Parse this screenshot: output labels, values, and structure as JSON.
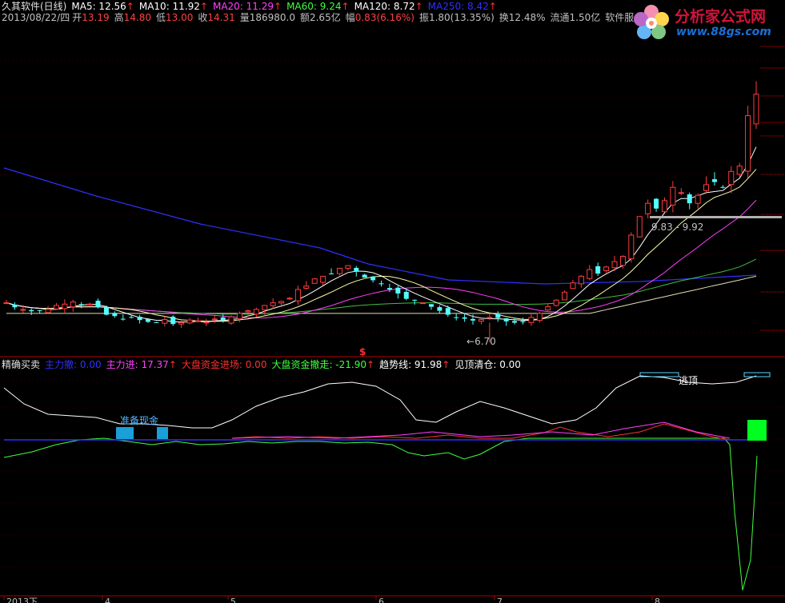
{
  "header": {
    "title": "久其软件(日线)",
    "ma": [
      {
        "label": "MA5: 12.56",
        "color": "#ffffff",
        "arrow": "↑"
      },
      {
        "label": "MA10: 11.92",
        "color": "#ffffff",
        "arrow": "↑"
      },
      {
        "label": "MA20: 11.29",
        "color": "#ff40ff",
        "arrow": "↑"
      },
      {
        "label": "MA60: 9.24",
        "color": "#40ff40",
        "arrow": "↑"
      },
      {
        "label": "MA120: 8.72",
        "color": "#ffffff",
        "arrow": "↑"
      },
      {
        "label": "MA250: 8.42",
        "color": "#3030ff",
        "arrow": "↑"
      }
    ],
    "quote": {
      "date": "2013/08/22/四",
      "open_label": "开",
      "open": "13.19",
      "high_label": "高",
      "high": "14.80",
      "low_label": "低",
      "low": "13.00",
      "close_label": "收",
      "close": "14.31",
      "vol": "量186980.0",
      "amt": "额2.65亿",
      "chg_label": "幅",
      "chg": "0.83(6.16%)",
      "amp": "振1.80(13.35%)",
      "turn": "换12.48%",
      "float": "流通1.50亿",
      "service": "软件服务"
    }
  },
  "logo": {
    "line1": "分析家公式网",
    "line2": "www.88gs.com"
  },
  "price_panel": {
    "range_label": "9.83 - 9.92",
    "low_marker": "6.70",
    "signal_marker": "$"
  },
  "indicator": {
    "name": "精确买卖",
    "items": [
      {
        "label": "主力撤: 0.00",
        "color": "#3030ff"
      },
      {
        "label": "主力进: 17.37",
        "color": "#ff40ff",
        "arrow": "↑"
      },
      {
        "label": "大盘资金进场: 0.00",
        "color": "#ff3030"
      },
      {
        "label": "大盘资金撤走: -21.90",
        "color": "#40ff40",
        "arrow": "↑"
      },
      {
        "label": "趋势线: 91.98",
        "color": "#ffffff",
        "arrow": "↑"
      },
      {
        "label": "见顶清仓: 0.00",
        "color": "#ffffff"
      }
    ],
    "escape_label": "逃顶",
    "cash_label": "准备现金"
  },
  "x_axis": {
    "labels": [
      "2013下",
      "4",
      "5",
      "6",
      "7",
      "8"
    ]
  },
  "colors": {
    "up": "#ff3c3c",
    "down": "#54ffff",
    "grid": "#7a0000",
    "axis": "#b00000"
  },
  "chart_data": {
    "type": "candlestick",
    "closes": [
      6.45,
      6.28,
      6.2,
      6.13,
      6.15,
      6.2,
      6.35,
      6.4,
      6.48,
      6.35,
      6.4,
      6.28,
      6.0,
      5.95,
      5.82,
      5.9,
      5.8,
      5.73,
      5.7,
      5.82,
      5.65,
      5.7,
      5.8,
      5.77,
      5.72,
      5.84,
      5.8,
      5.92,
      6.05,
      6.15,
      6.2,
      6.35,
      6.45,
      6.5,
      6.62,
      6.95,
      7.08,
      7.35,
      7.45,
      7.55,
      7.75,
      7.85,
      7.62,
      7.4,
      7.3,
      7.15,
      6.95,
      6.8,
      6.6,
      6.55,
      6.45,
      6.3,
      6.15,
      6.0,
      5.9,
      5.85,
      5.78,
      5.82,
      5.9,
      5.88,
      5.75,
      5.7,
      5.72,
      5.9,
      6.05,
      6.3,
      6.55,
      6.85,
      7.2,
      7.45,
      7.7,
      7.55,
      7.8,
      8.0,
      8.2,
      9.0,
      9.7,
      10.2,
      10.0,
      10.3,
      10.8,
      10.6,
      10.2,
      10.5,
      10.9,
      11.0,
      10.8,
      11.4,
      11.6,
      13.5,
      14.31
    ]
  }
}
